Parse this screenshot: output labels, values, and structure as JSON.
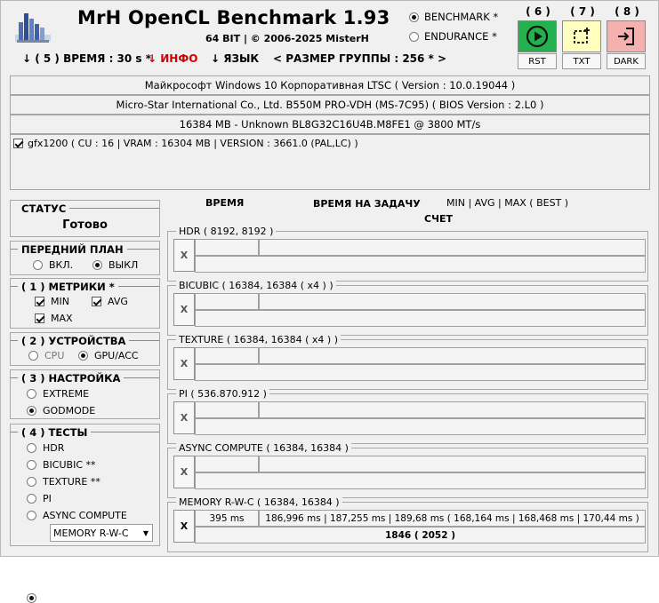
{
  "header": {
    "title": "MrH OpenCL Benchmark 1.93",
    "subtitle": "64 BIT | ©  2006-2025 MisterH",
    "modes": [
      {
        "label": "BENCHMARK *",
        "selected": true
      },
      {
        "label": "ENDURANCE *",
        "selected": false
      }
    ],
    "toolbar": [
      {
        "num": "( 6 )",
        "label": "RST",
        "color": "#22b14c",
        "icon": "play-icon"
      },
      {
        "num": "( 7 )",
        "label": "TXT",
        "color": "#ffffc0",
        "icon": "crop-select-icon"
      },
      {
        "num": "( 8 )",
        "label": "DARK",
        "color": "#f5b0b0",
        "icon": "sign-in-icon"
      }
    ],
    "menu": {
      "time": "↓ ( 5 ) ВРЕМЯ : 30 s *",
      "info": "↓ ИНФО",
      "lang": "↓ ЯЗЫК",
      "group": "< РАЗМЕР ГРУППЫ : 256 * >",
      "info_color": "#d40000"
    }
  },
  "system": {
    "os": "Майкрософт Windows 10 Корпоративная LTSC ( Version : 10.0.19044 )",
    "board": "Micro-Star International Co., Ltd. B550M PRO-VDH (MS-7C95) ( BIOS Version : 2.L0 )",
    "memory": "16384 MB - Unknown BL8G32C16U4B.M8FE1 @ 3800 MT/s",
    "device": "gfx1200 ( CU : 16 | VRAM : 16304 MB | VERSION : 3661.0 (PAL,LC) )"
  },
  "status": {
    "title": "СТАТУС",
    "value": "Готово"
  },
  "foreground": {
    "title": "ПЕРЕДНИЙ ПЛАН",
    "on": "ВКЛ.",
    "off": "ВЫКЛ",
    "selected": "off"
  },
  "metrics": {
    "title": "( 1 ) МЕТРИКИ *",
    "min": "MIN",
    "avg": "AVG",
    "max": "MAX"
  },
  "devices": {
    "title": "( 2 ) УСТРОЙСТВА",
    "cpu": "CPU",
    "gpu": "GPU/ACC",
    "selected": "gpu"
  },
  "tuning": {
    "title": "( 3 ) НАСТРОЙКА",
    "extreme": "EXTREME",
    "godmode": "GODMODE",
    "selected": "godmode"
  },
  "tests_panel": {
    "title": "( 4 ) ТЕСТЫ",
    "items": [
      "HDR",
      "BICUBIC **",
      "TEXTURE **",
      "PI",
      "ASYNC COMPUTE"
    ],
    "selected_value": "MEMORY R-W-C"
  },
  "columns": {
    "time": "ВРЕМЯ",
    "per_task": "ВРЕМЯ НА ЗАДАЧУ",
    "stats": "MIN | AVG | MAX ( BEST )",
    "score": "СЧЕТ"
  },
  "tests": [
    {
      "name": "HDR ( 8192, 8192 )",
      "x": "X",
      "time": "",
      "task": "",
      "score": ""
    },
    {
      "name": "BICUBIC ( 16384, 16384 ( x4 ) )",
      "x": "X",
      "time": "",
      "task": "",
      "score": ""
    },
    {
      "name": "TEXTURE ( 16384, 16384 ( x4 ) )",
      "x": "X",
      "time": "",
      "task": "",
      "score": ""
    },
    {
      "name": "PI ( 536.870.912 )",
      "x": "X",
      "time": "",
      "task": "",
      "score": ""
    },
    {
      "name": "ASYNC COMPUTE ( 16384, 16384 )",
      "x": "X",
      "time": "",
      "task": "",
      "score": ""
    },
    {
      "name": "MEMORY R-W-C ( 16384, 16384 )",
      "x": "X",
      "time": "395 ms",
      "task": "186,996 ms | 187,255 ms | 189,68 ms  ( 168,164 ms | 168,468 ms | 170,44 ms )",
      "score": "1846  ( 2052 )"
    }
  ]
}
